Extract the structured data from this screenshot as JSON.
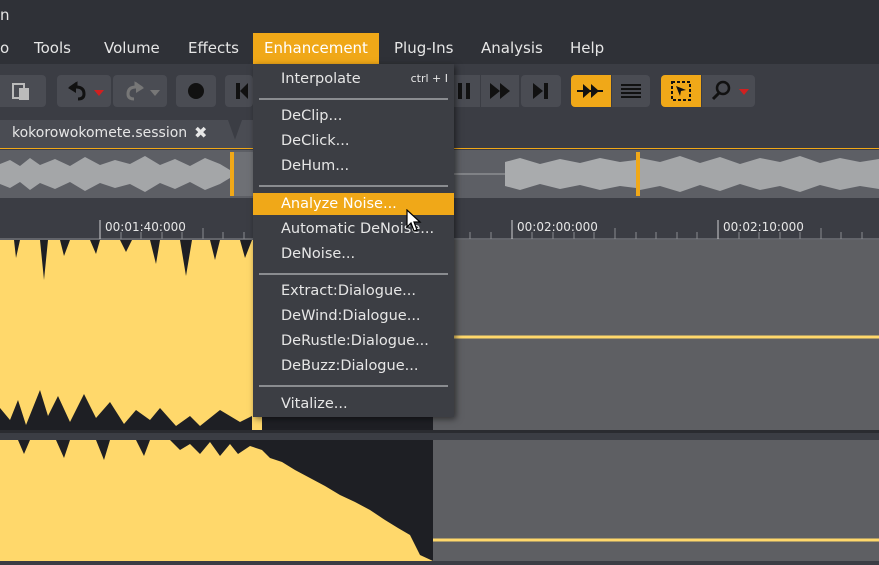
{
  "window": {
    "title_fragment": "n"
  },
  "menubar": {
    "items": [
      {
        "label": "o"
      },
      {
        "label": "Tools"
      },
      {
        "label": "Volume"
      },
      {
        "label": "Effects"
      },
      {
        "label": "Enhancement"
      },
      {
        "label": "Plug-Ins"
      },
      {
        "label": "Analysis"
      },
      {
        "label": "Help"
      }
    ]
  },
  "toolbar": {
    "icons": [
      "paste-icon",
      "undo-icon",
      "redo-icon",
      "record-icon",
      "skip-start-icon",
      "pause-icon",
      "fast-forward-icon",
      "skip-end-icon",
      "scrub-icon",
      "waveform-view-icon",
      "select-tool-icon",
      "zoom-icon"
    ]
  },
  "tabs": {
    "session_name": "kokorowokomete.session",
    "close_symbol": "✖"
  },
  "ruler": {
    "labels": [
      "00:01:40:000",
      "00:02:00:000",
      "00:02:10:000"
    ]
  },
  "enhancement_menu": {
    "items": [
      {
        "label": "Interpolate",
        "shortcut": "ctrl + I"
      },
      {
        "label": "DeClip..."
      },
      {
        "label": "DeClick..."
      },
      {
        "label": "DeHum..."
      },
      {
        "label": "Analyze Noise..."
      },
      {
        "label": "Automatic DeNoise..."
      },
      {
        "label": "DeNoise..."
      },
      {
        "label": "Extract:Dialogue..."
      },
      {
        "label": "DeWind:Dialogue..."
      },
      {
        "label": "DeRustle:Dialogue..."
      },
      {
        "label": "DeBuzz:Dialogue..."
      },
      {
        "label": "Vitalize..."
      }
    ],
    "highlighted": "Analyze Noise..."
  },
  "colors": {
    "accent": "#f0a818",
    "waveform": "#ffd86b",
    "background": "#3b3d44"
  }
}
